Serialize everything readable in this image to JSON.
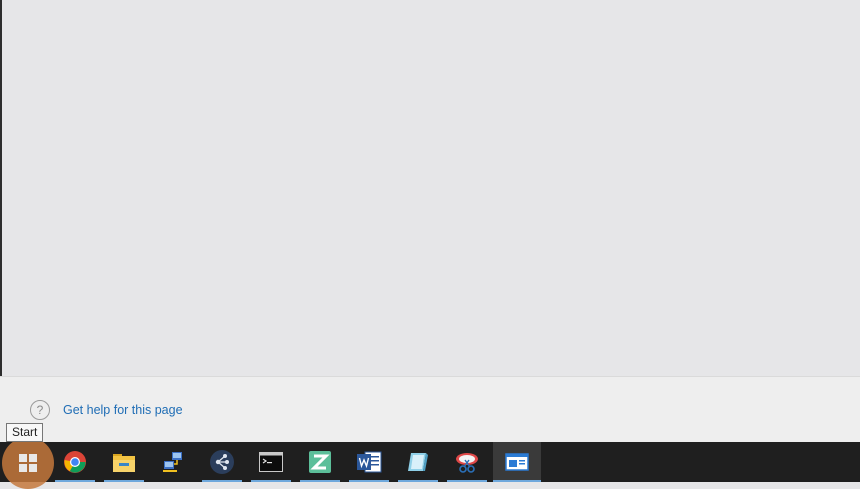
{
  "footer": {
    "help_link": "Get help for this page",
    "help_icon": "?"
  },
  "tooltip": {
    "text": "Start"
  },
  "taskbar": {
    "start_label": "Start",
    "items": [
      {
        "name": "chrome",
        "running": true
      },
      {
        "name": "file-explorer",
        "running": true
      },
      {
        "name": "network-app",
        "running": false
      },
      {
        "name": "hub-app",
        "running": true
      },
      {
        "name": "command-prompt",
        "running": true
      },
      {
        "name": "z-app",
        "running": true
      },
      {
        "name": "word",
        "running": true
      },
      {
        "name": "notepad-app",
        "running": true
      },
      {
        "name": "snipping-tool",
        "running": true
      },
      {
        "name": "active-window",
        "running": true
      }
    ]
  },
  "colors": {
    "accent": "#1f6db5",
    "start_highlight": "#c4783c",
    "taskbar": "#1f1f1f"
  }
}
